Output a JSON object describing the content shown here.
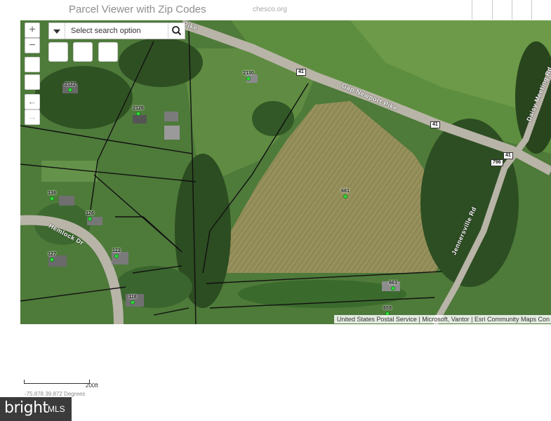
{
  "app": {
    "title": "Parcel Viewer with Zip Codes",
    "url": "chesco.org"
  },
  "search": {
    "placeholder": "Select search option"
  },
  "zoom": {
    "in_label": "+",
    "out_label": "−"
  },
  "nav": {
    "back_label": "←",
    "forward_label": "→"
  },
  "roads": [
    {
      "name": "Gap Newport Pike"
    },
    {
      "name": "Jennersville Rd"
    },
    {
      "name": "Hemlock Dr"
    },
    {
      "name": "Daisy Meeting Rd"
    },
    {
      "name": "Pike"
    }
  ],
  "route_shields": [
    "41",
    "41",
    "41",
    "796"
  ],
  "parcels": [
    "2130",
    "2122",
    "2126",
    "136",
    "126",
    "127",
    "122",
    "118",
    "681",
    "663",
    "659"
  ],
  "attribution": "United States Postal Service | Microsoft, Vantor | Esri Community Maps Con",
  "scale": {
    "label": "200ft"
  },
  "coordinates": "-75.878 39.872 Degrees",
  "logo": {
    "word": "bright",
    "suffix": "MLS"
  },
  "colors": {
    "parcel_dot": "#2fe13a",
    "parcel_line": "#111111",
    "road": "#b9b4a8",
    "logo_bg": "#3b3b3b"
  }
}
